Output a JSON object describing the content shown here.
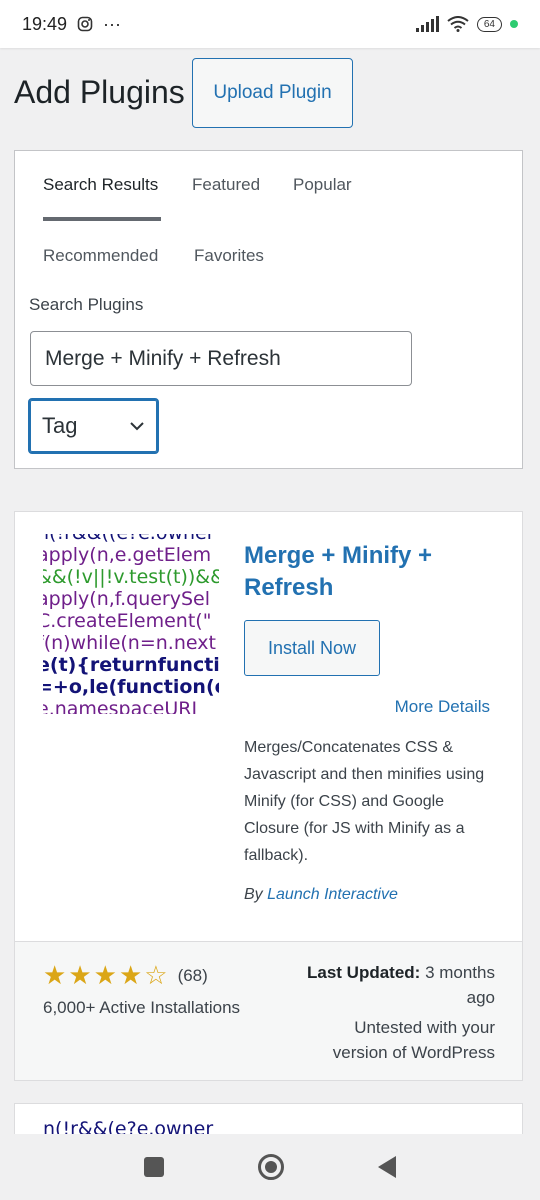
{
  "status_bar": {
    "time": "19:49",
    "battery": "64"
  },
  "header": {
    "title": "Add Plugins",
    "upload_label": "Upload Plugin"
  },
  "filter": {
    "tabs": [
      {
        "label": "Search Results",
        "active": true
      },
      {
        "label": "Featured",
        "active": false
      },
      {
        "label": "Popular",
        "active": false
      },
      {
        "label": "Recommended",
        "active": false
      },
      {
        "label": "Favorites",
        "active": false
      }
    ],
    "search_label": "Search Plugins",
    "search_value": "Merge + Minify + Refresh",
    "search_type": "Tag"
  },
  "plugin": {
    "name": "Merge + Minify + Refresh",
    "install_label": "Install Now",
    "more_details_label": "More Details",
    "description": "Merges/Concatenates CSS & Javascript and then minifies using Minify (for CSS) and Google Closure (for JS with Minify as a fallback).",
    "by_prefix": "By",
    "author": "Launch Interactive",
    "rating_stars": 4,
    "rating_count": "(68)",
    "installs": "6,000+ Active Installations",
    "last_updated_label": "Last Updated:",
    "last_updated_value": "3 months ago",
    "compatibility": "Untested with your version of WordPress",
    "thumbnail_lines": [
      "n(!r&&((e?e.owner",
      "apply(n,e.getElem",
      "&&(!v||!v.test(t))&&(",
      "apply(n,f.querySel",
      "C.createElement(\"",
      "f(n)while(n=n.next",
      "e(t){returnfunction",
      "=+o,le(function(e,t",
      "e.namespaceURI"
    ]
  },
  "next_plugin": {
    "thumbnail_peek": "n(!r&&(e?e.owner"
  }
}
